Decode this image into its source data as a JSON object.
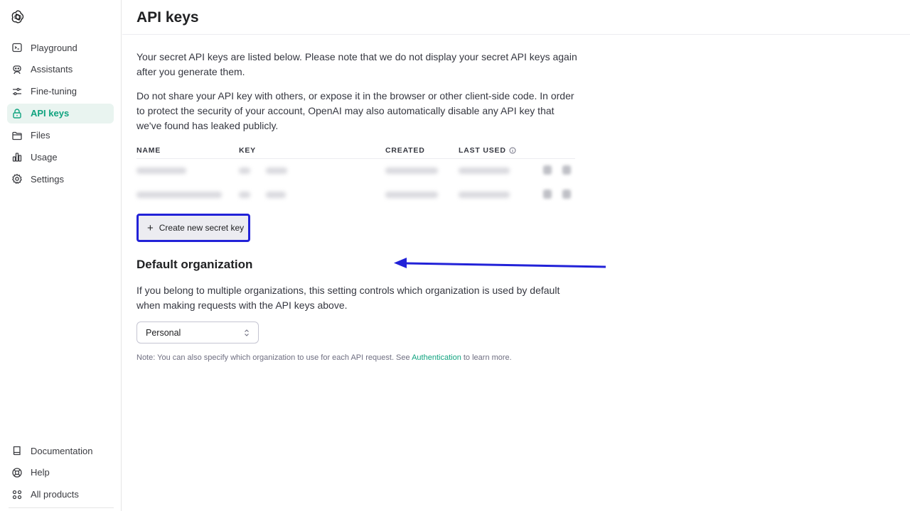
{
  "sidebar": {
    "nav": [
      {
        "label": "Playground",
        "icon": "terminal-icon"
      },
      {
        "label": "Assistants",
        "icon": "robot-icon"
      },
      {
        "label": "Fine-tuning",
        "icon": "sliders-icon"
      },
      {
        "label": "API keys",
        "icon": "lock-icon",
        "active": true
      },
      {
        "label": "Files",
        "icon": "folder-icon"
      },
      {
        "label": "Usage",
        "icon": "bar-chart-icon"
      },
      {
        "label": "Settings",
        "icon": "gear-icon"
      }
    ],
    "bottom": [
      {
        "label": "Documentation",
        "icon": "book-icon"
      },
      {
        "label": "Help",
        "icon": "lifebuoy-icon"
      },
      {
        "label": "All products",
        "icon": "grid-icon"
      }
    ]
  },
  "header": {
    "title": "API keys"
  },
  "main": {
    "intro": "Your secret API keys are listed below. Please note that we do not display your secret API keys again after you generate them.",
    "warning": "Do not share your API key with others, or expose it in the browser or other client-side code. In order to protect the security of your account, OpenAI may also automatically disable any API key that we've found has leaked publicly.",
    "table": {
      "columns": [
        "NAME",
        "KEY",
        "CREATED",
        "LAST USED"
      ]
    },
    "create_button": "Create new secret key",
    "org_title": "Default organization",
    "org_text": "If you belong to multiple organizations, this setting controls which organization is used by default when making requests with the API keys above.",
    "org_select": "Personal",
    "note_prefix": "Note: You can also specify which organization to use for each API request. See ",
    "note_link": "Authentication",
    "note_suffix": " to learn more."
  },
  "colors": {
    "accent": "#10a37f",
    "annotation": "#2222d8"
  }
}
